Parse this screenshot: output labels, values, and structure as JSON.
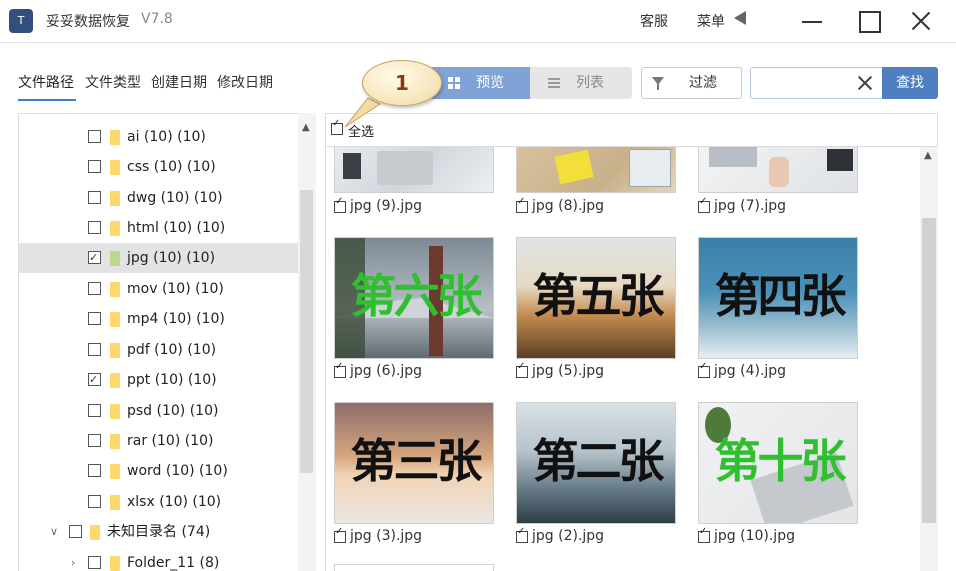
{
  "window": {
    "logo_text": "T",
    "title": "妥妥数据恢复",
    "version": "V7.8",
    "service": "客服",
    "menu": "菜单"
  },
  "tabs": [
    {
      "label": "文件路径",
      "active": true
    },
    {
      "label": "文件类型"
    },
    {
      "label": "创建日期"
    },
    {
      "label": "修改日期"
    }
  ],
  "toolbar": {
    "preview": "预览",
    "list": "列表",
    "filter": "过滤",
    "search_value": "",
    "search_button": "查找"
  },
  "annotation": {
    "number": "1",
    "color": "#8a3a10"
  },
  "tree": {
    "items": [
      {
        "label": "ai (10)  (10)",
        "checked": false
      },
      {
        "label": "css (10)  (10)",
        "checked": false
      },
      {
        "label": "dwg (10)  (10)",
        "checked": false
      },
      {
        "label": "html (10)  (10)",
        "checked": false
      },
      {
        "label": "jpg (10)  (10)",
        "checked": true,
        "selected": true
      },
      {
        "label": "mov (10)  (10)",
        "checked": false
      },
      {
        "label": "mp4 (10)  (10)",
        "checked": false
      },
      {
        "label": "pdf (10)  (10)",
        "checked": false
      },
      {
        "label": "ppt (10)  (10)",
        "checked": true
      },
      {
        "label": "psd (10)  (10)",
        "checked": false
      },
      {
        "label": "rar (10)  (10)",
        "checked": false
      },
      {
        "label": "word (10)  (10)",
        "checked": false
      },
      {
        "label": "xlsx (10)  (10)",
        "checked": false
      }
    ],
    "unknown": {
      "label": "未知目录名  (74)",
      "checked": false
    },
    "folder11": {
      "label": "Folder_11  (8)",
      "checked": false
    }
  },
  "grid": {
    "select_all": "全选",
    "top_row": [
      {
        "caption": "jpg (9).jpg"
      },
      {
        "caption": "jpg (8).jpg"
      },
      {
        "caption": "jpg (7).jpg"
      }
    ],
    "rows": [
      [
        {
          "caption": "jpg (6).jpg",
          "overlay": "第六张",
          "text_color": "#2fbf2f"
        },
        {
          "caption": "jpg (5).jpg",
          "overlay": "第五张",
          "text_color": "#111111"
        },
        {
          "caption": "jpg (4).jpg",
          "overlay": "第四张",
          "text_color": "#111111"
        }
      ],
      [
        {
          "caption": "jpg (3).jpg",
          "overlay": "第三张",
          "text_color": "#111111"
        },
        {
          "caption": "jpg (2).jpg",
          "overlay": "第二张",
          "text_color": "#111111"
        },
        {
          "caption": "jpg (10).jpg",
          "overlay": "第十张",
          "text_color": "#2fbf2f"
        }
      ]
    ]
  },
  "colors": {
    "accent": "#4f7fc1",
    "preview_active": "#7fa3d6",
    "tab_underline": "#3d7fd0"
  }
}
